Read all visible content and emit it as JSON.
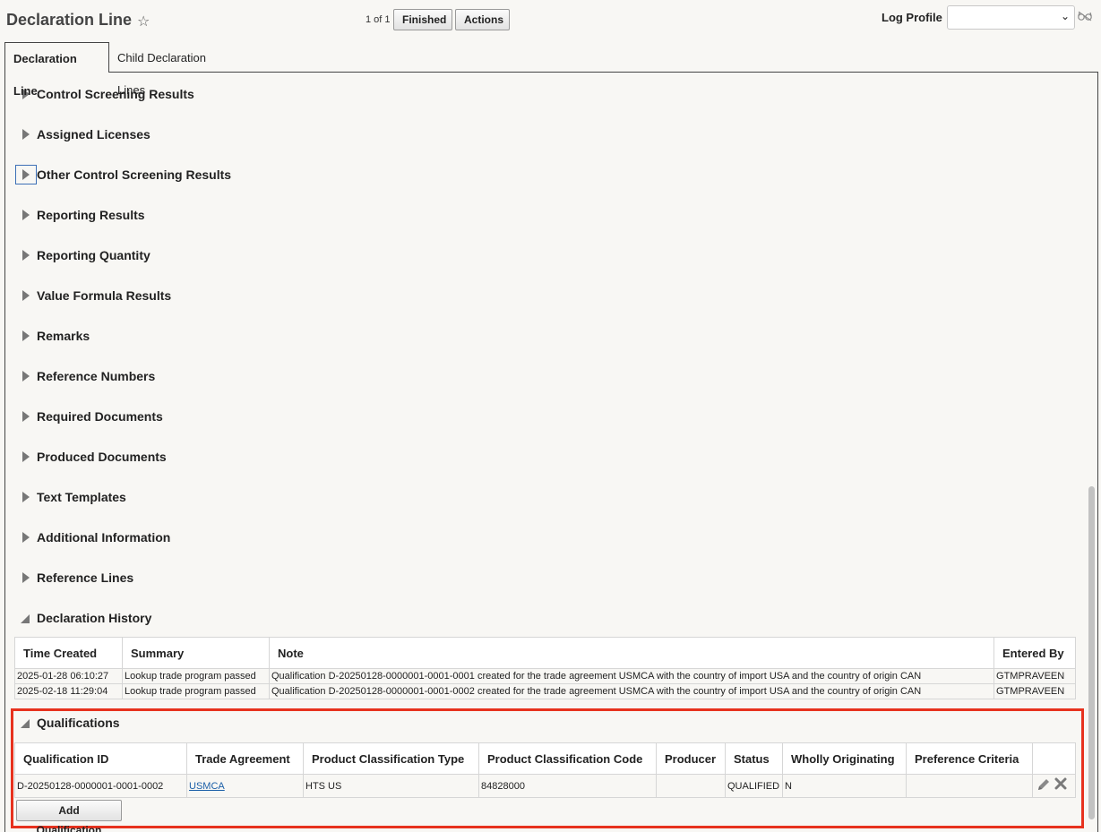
{
  "header": {
    "title": "Declaration Line",
    "pager": "1 of 1",
    "finished_label": "Finished",
    "actions_label": "Actions",
    "log_profile_label": "Log Profile",
    "log_profile_value": ""
  },
  "tabs": [
    {
      "label": "Declaration Line",
      "active": true
    },
    {
      "label": "Child Declaration Lines",
      "active": false
    }
  ],
  "sections": [
    {
      "label": "Control Screening Results",
      "expanded": false
    },
    {
      "label": "Assigned Licenses",
      "expanded": false
    },
    {
      "label": "Other Control Screening Results",
      "expanded": false,
      "focused": true
    },
    {
      "label": "Reporting Results",
      "expanded": false
    },
    {
      "label": "Reporting Quantity",
      "expanded": false
    },
    {
      "label": "Value Formula Results",
      "expanded": false
    },
    {
      "label": "Remarks",
      "expanded": false
    },
    {
      "label": "Reference Numbers",
      "expanded": false
    },
    {
      "label": "Required Documents",
      "expanded": false
    },
    {
      "label": "Produced Documents",
      "expanded": false
    },
    {
      "label": "Text Templates",
      "expanded": false
    },
    {
      "label": "Additional Information",
      "expanded": false
    },
    {
      "label": "Reference Lines",
      "expanded": false
    },
    {
      "label": "Declaration History",
      "expanded": true
    }
  ],
  "history": {
    "columns": [
      "Time Created",
      "Summary",
      "Note",
      "Entered By"
    ],
    "rows": [
      [
        "2025-01-28 06:10:27",
        "Lookup trade program passed",
        "Qualification D-20250128-0000001-0001-0001 created for the trade agreement USMCA with the country of import USA and the country of origin CAN",
        "GTMPRAVEEN"
      ],
      [
        "2025-02-18 11:29:04",
        "Lookup trade program passed",
        "Qualification D-20250128-0000001-0001-0002 created for the trade agreement USMCA with the country of import USA and the country of origin CAN",
        "GTMPRAVEEN"
      ]
    ]
  },
  "qualifications": {
    "title": "Qualifications",
    "expanded": true,
    "columns": [
      "Qualification ID",
      "Trade Agreement",
      "Product Classification Type",
      "Product Classification Code",
      "Producer",
      "Status",
      "Wholly Originating",
      "Preference Criteria",
      ""
    ],
    "rows": [
      [
        "D-20250128-0000001-0001-0002",
        "USMCA",
        "HTS US",
        "84828000",
        "",
        "QUALIFIED",
        "N",
        ""
      ]
    ],
    "add_label": "Add Qualification"
  },
  "icons": {
    "star": "star-icon",
    "glasses": "glasses-icon",
    "edit": "pencil-icon",
    "delete": "close-icon"
  },
  "colors": {
    "highlight": "#e7321e",
    "link": "#1b5fa8"
  }
}
